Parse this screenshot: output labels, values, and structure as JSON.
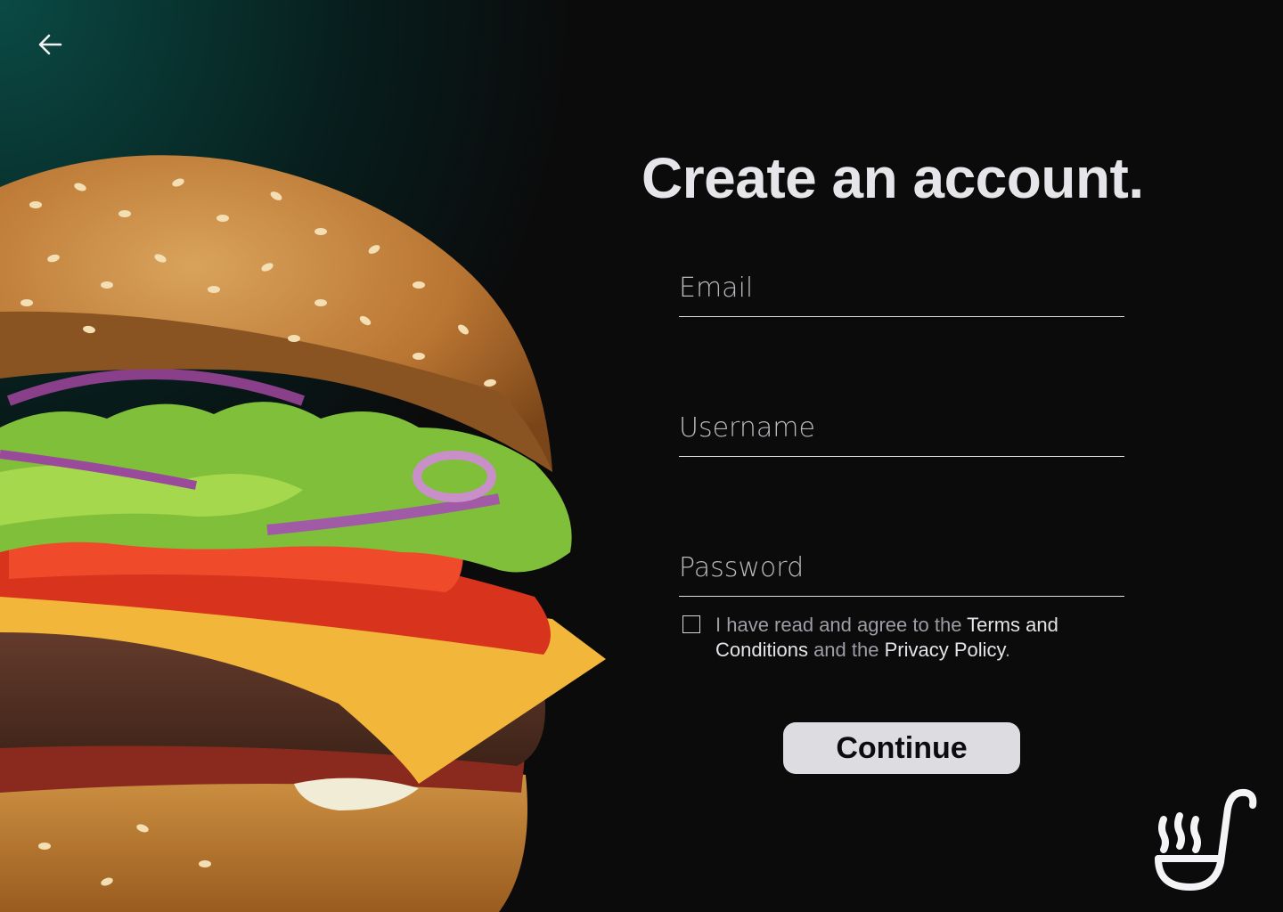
{
  "back": {
    "icon": "arrow-left-icon"
  },
  "title": "Create an account.",
  "form": {
    "email_placeholder": "Email",
    "username_placeholder": "Username",
    "password_placeholder": "Password",
    "terms": {
      "prefix": "I have read and agree to the ",
      "terms_link": "Terms and Conditions",
      "middle": " and the ",
      "privacy_link": "Privacy Policy",
      "suffix": "."
    },
    "continue_label": "Continue"
  },
  "hero_image": {
    "subject": "burger-image"
  },
  "logo": {
    "icon": "steaming-ladle-logo"
  },
  "colors": {
    "background": "#0b0b0c",
    "teal_glow": "#0b4a45",
    "button_bg": "#dcdce1",
    "text": "#e6e6ea"
  }
}
